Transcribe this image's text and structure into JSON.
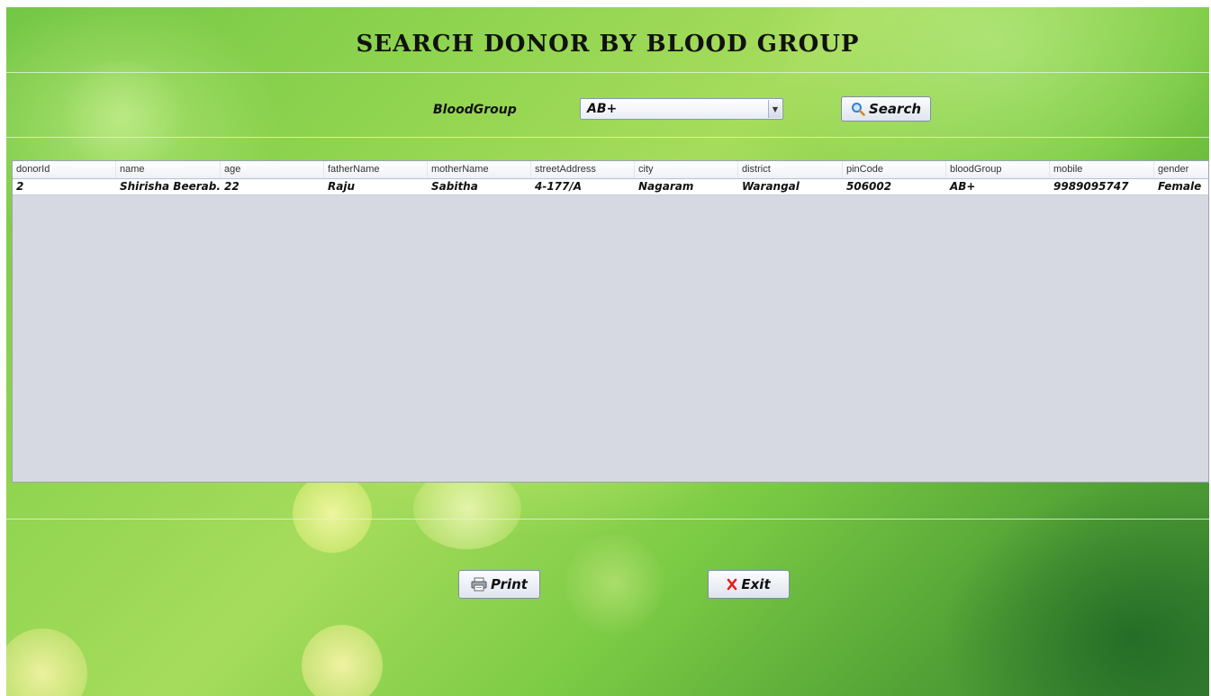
{
  "title": "SEARCH DONOR BY BLOOD GROUP",
  "search": {
    "label": "BloodGroup",
    "selected_value": "AB+",
    "button_label": "Search"
  },
  "table": {
    "columns": [
      "donorId",
      "name",
      "age",
      "fatherName",
      "motherName",
      "streetAddress",
      "city",
      "district",
      "pinCode",
      "bloodGroup",
      "mobile",
      "gender"
    ],
    "rows": [
      [
        "2",
        "Shirisha Beerab...",
        "22",
        "Raju",
        "Sabitha",
        "4-177/A",
        "Nagaram",
        "Warangal",
        "506002",
        "AB+",
        "9989095747",
        "Female"
      ]
    ]
  },
  "footer": {
    "print_label": "Print",
    "exit_label": "Exit"
  },
  "icons": {
    "search": "magnifier-icon",
    "print": "printer-icon",
    "exit": "red-x-icon",
    "combo_arrow": "chevron-down-icon"
  },
  "colors": {
    "background_green": "#8fd44f",
    "table_bg": "#d6d9e2",
    "exit_icon": "#e0201b",
    "search_icon": "#2f7fd6"
  }
}
